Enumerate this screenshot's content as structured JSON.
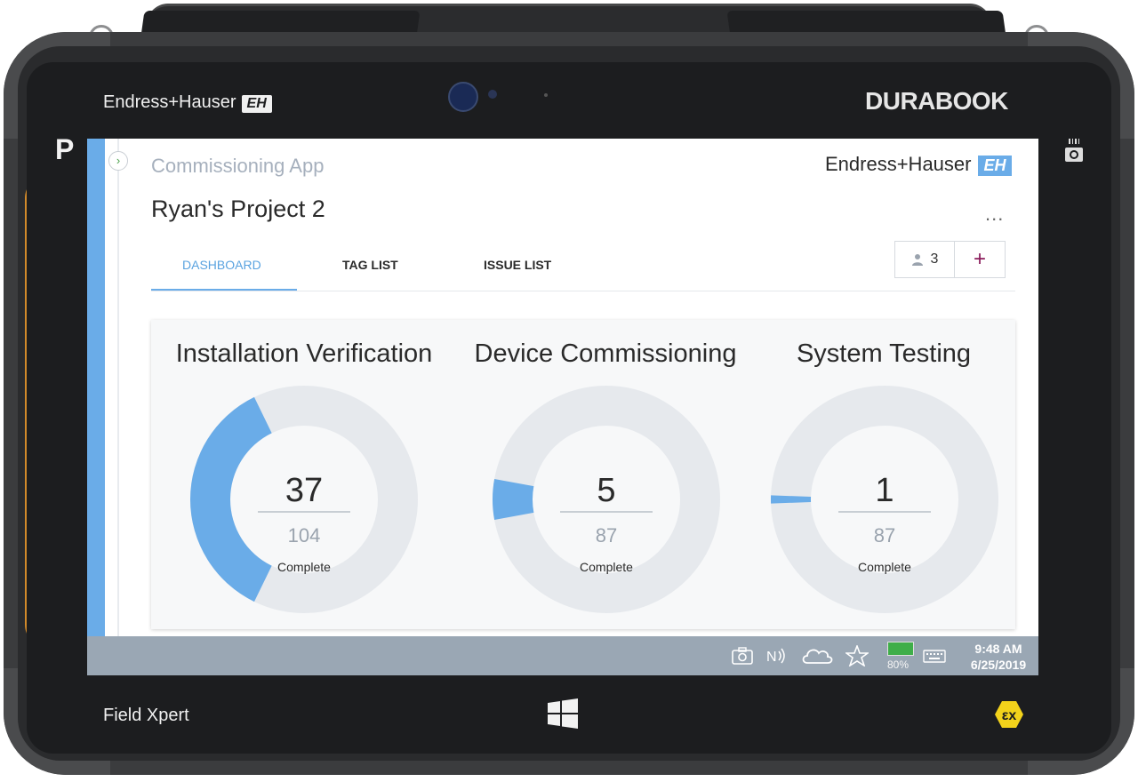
{
  "bezel": {
    "brand": "Endress+Hauser",
    "brand_logo": "EH",
    "device_brand": "DURABOOK",
    "p_key": "P",
    "model": "Field Xpert"
  },
  "header": {
    "app_title": "Commissioning App",
    "brand": "Endress+Hauser",
    "brand_logo": "EH",
    "project_title": "Ryan's Project 2",
    "more": "..."
  },
  "tabs": [
    {
      "label": "DASHBOARD",
      "active": true
    },
    {
      "label": "TAG LIST",
      "active": false
    },
    {
      "label": "ISSUE LIST",
      "active": false
    }
  ],
  "toolbar": {
    "user_count": "3",
    "add_label": "+"
  },
  "dashboard": {
    "cards": [
      {
        "title": "Installation Verification",
        "complete": 37,
        "total": 104,
        "label": "Complete"
      },
      {
        "title": "Device Commissioning",
        "complete": 5,
        "total": 87,
        "label": "Complete"
      },
      {
        "title": "System Testing",
        "complete": 1,
        "total": 87,
        "label": "Complete"
      }
    ]
  },
  "taskbar": {
    "battery": "80%",
    "time": "9:48 AM",
    "date": "6/25/2019"
  },
  "colors": {
    "accent": "#6aace8",
    "track": "#e6e9ed",
    "add": "#8a1a5a"
  }
}
